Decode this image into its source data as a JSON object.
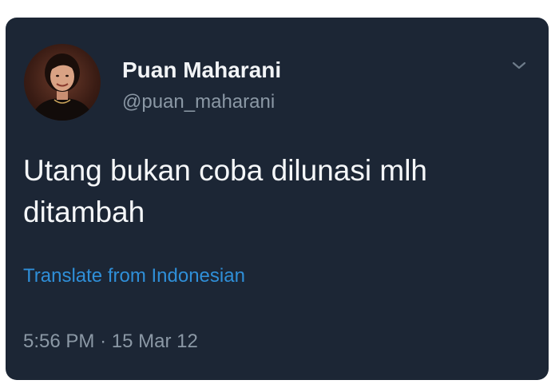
{
  "tweet": {
    "author_name": "Puan Maharani",
    "author_handle": "@puan_maharani",
    "text": "Utang bukan coba dilunasi mlh ditambah",
    "translate_label": "Translate from Indonesian",
    "time": "5:56 PM",
    "separator": "·",
    "date": "15 Mar 12",
    "avatar_icon": "profile-photo",
    "menu_icon": "chevron-down-icon"
  },
  "colors": {
    "card_background": "#1c2635",
    "page_background": "#ffffff",
    "name_text": "#f2f4f6",
    "secondary_text": "#8b98a5",
    "link_text": "#2f8fd8"
  }
}
